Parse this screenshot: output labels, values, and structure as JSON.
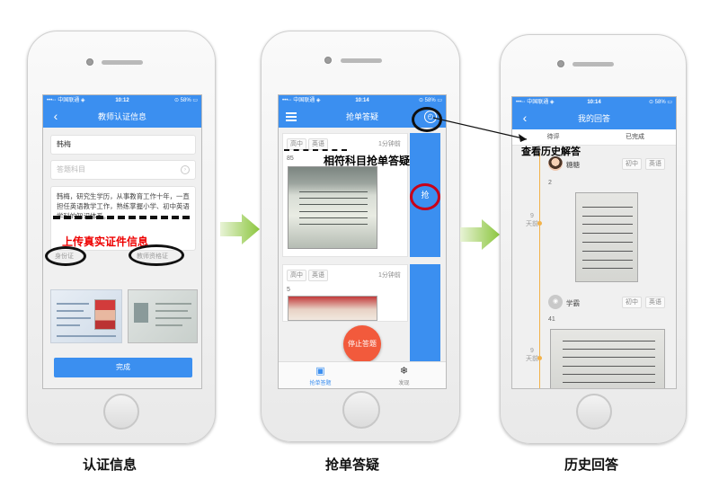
{
  "phone1": {
    "status": {
      "carrier": "•••◦◦ 中国联通 ◈",
      "time": "10:12",
      "battery": "⊙ 58% ▭"
    },
    "title": "教师认证信息",
    "name_value": "韩梅",
    "subject_placeholder": "答题科目",
    "bio": "韩梅，研究生学历，从事教育工作十年，一直担任英语教学工作，熟练掌握小学、初中英语学科的知识体系。",
    "annotation_upload": "上传真实证件信息",
    "id_card_label": "身份证",
    "teacher_cert_label": "教师资格证",
    "done_button": "完成"
  },
  "phone2": {
    "status": {
      "carrier": "•••◦◦ 中国联通 ◈",
      "time": "10:14",
      "battery": "⊙ 58% ▭"
    },
    "title": "抢单答疑",
    "annotation_match": "相符科目抢单答疑",
    "cards": [
      {
        "tags": [
          "高中",
          "英语"
        ],
        "time": "1分钟前",
        "count": "85"
      },
      {
        "tags": [
          "高中",
          "英语"
        ],
        "time": "1分钟前",
        "count": "5"
      }
    ],
    "grab_label": "抢",
    "stop_button": "停止答题",
    "tabs": [
      {
        "label": "抢单答题",
        "icon": "chat-check-icon"
      },
      {
        "label": "发现",
        "icon": "snowflake-icon"
      }
    ]
  },
  "phone3": {
    "status": {
      "carrier": "•••◦◦ 中国联通 ◈",
      "time": "10:14",
      "battery": "⊙ 58% ▭"
    },
    "title": "我的回答",
    "subtabs": [
      "待评",
      "已完成"
    ],
    "annotation_history": "查看历史解答",
    "answers": [
      {
        "user": "糖糖",
        "tags": [
          "初中",
          "英语"
        ],
        "count": "2",
        "day": "9",
        "unit": "天前"
      },
      {
        "user": "学霸",
        "tags": [
          "初中",
          "英语"
        ],
        "count": "41",
        "day": "9",
        "unit": "天前"
      }
    ]
  },
  "captions": [
    "认证信息",
    "抢单答疑",
    "历史回答"
  ],
  "colors": {
    "accent": "#3b8ff0",
    "arrow": "#8cc63f",
    "annotation_red": "#ee0000",
    "stop": "#f25a3c",
    "timeline": "#f2b24a"
  }
}
